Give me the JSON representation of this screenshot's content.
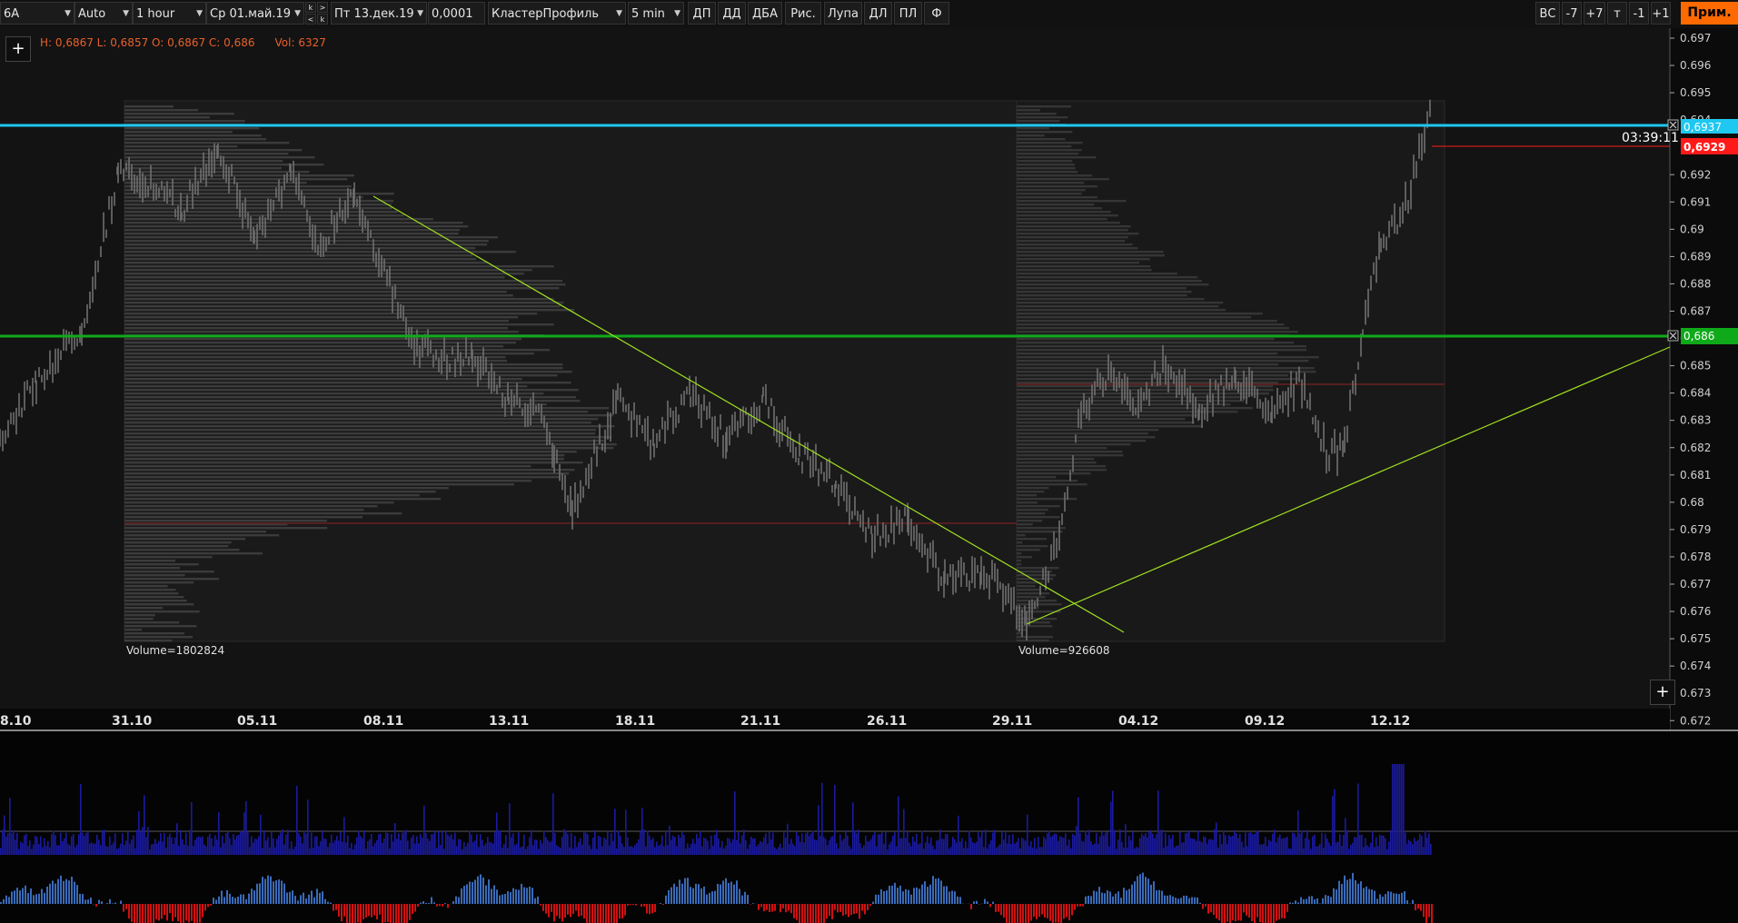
{
  "toolbar": {
    "instrument": "6A",
    "scale_mode": "Auto",
    "timeframe": "1 hour",
    "date_from": "Ср 01.май.19",
    "date_to": "Пт 13.дек.19",
    "tick_size": "0,0001",
    "chart_type": "КластерПрофиль",
    "cluster_period": "5 min",
    "buttons": [
      "ДП",
      "ДД",
      "ДБА",
      "Рис.",
      "Лупа",
      "ДЛ",
      "ПЛ",
      "Ф"
    ],
    "right_buttons": [
      "ВС",
      "-7",
      "+7",
      "т",
      "-1",
      "+1"
    ],
    "apply_label": "Прим.",
    "nav_glyphs": [
      "k",
      "<",
      ">",
      "k"
    ]
  },
  "hud": {
    "ohlc": "H: 0,6867  L: 0,6857  O: 0,6867  C: 0,686",
    "volume": "Vol: 6327"
  },
  "price_axis": {
    "ticks": [
      "0.697",
      "0.696",
      "0.695",
      "0.694",
      "0.692",
      "0.691",
      "0.69",
      "0.689",
      "0.688",
      "0.687",
      "0.686",
      "0.685",
      "0.684",
      "0.683",
      "0.682",
      "0.681",
      "0.68",
      "0.679",
      "0.678",
      "0.677",
      "0.676",
      "0.675",
      "0.674",
      "0.673",
      "0.672"
    ],
    "labels": {
      "resistance": "0,6937",
      "last": "0,6929",
      "support": "0,686"
    },
    "countdown": "03:39:11"
  },
  "date_axis": [
    "8.10",
    "31.10",
    "05.11",
    "08.11",
    "13.11",
    "18.11",
    "21.11",
    "26.11",
    "29.11",
    "04.12",
    "09.12",
    "12.12"
  ],
  "profiles": [
    {
      "label": "Volume=1802824"
    },
    {
      "label": "Volume=926608"
    }
  ],
  "colors": {
    "resistance_line": "#1ec8f0",
    "support_line": "#0faa1a",
    "trend_line": "#a0e020",
    "last_price": "#ff1a1a",
    "volume_bars": "#1a1aa0",
    "delta_positive": "#3a6ab8",
    "delta_negative": "#d01010",
    "accent": "#ff6a00",
    "hud_text": "#e8602c"
  },
  "icons": {
    "add_top": "+",
    "add_bottom": "+",
    "line_close": "✕"
  }
}
